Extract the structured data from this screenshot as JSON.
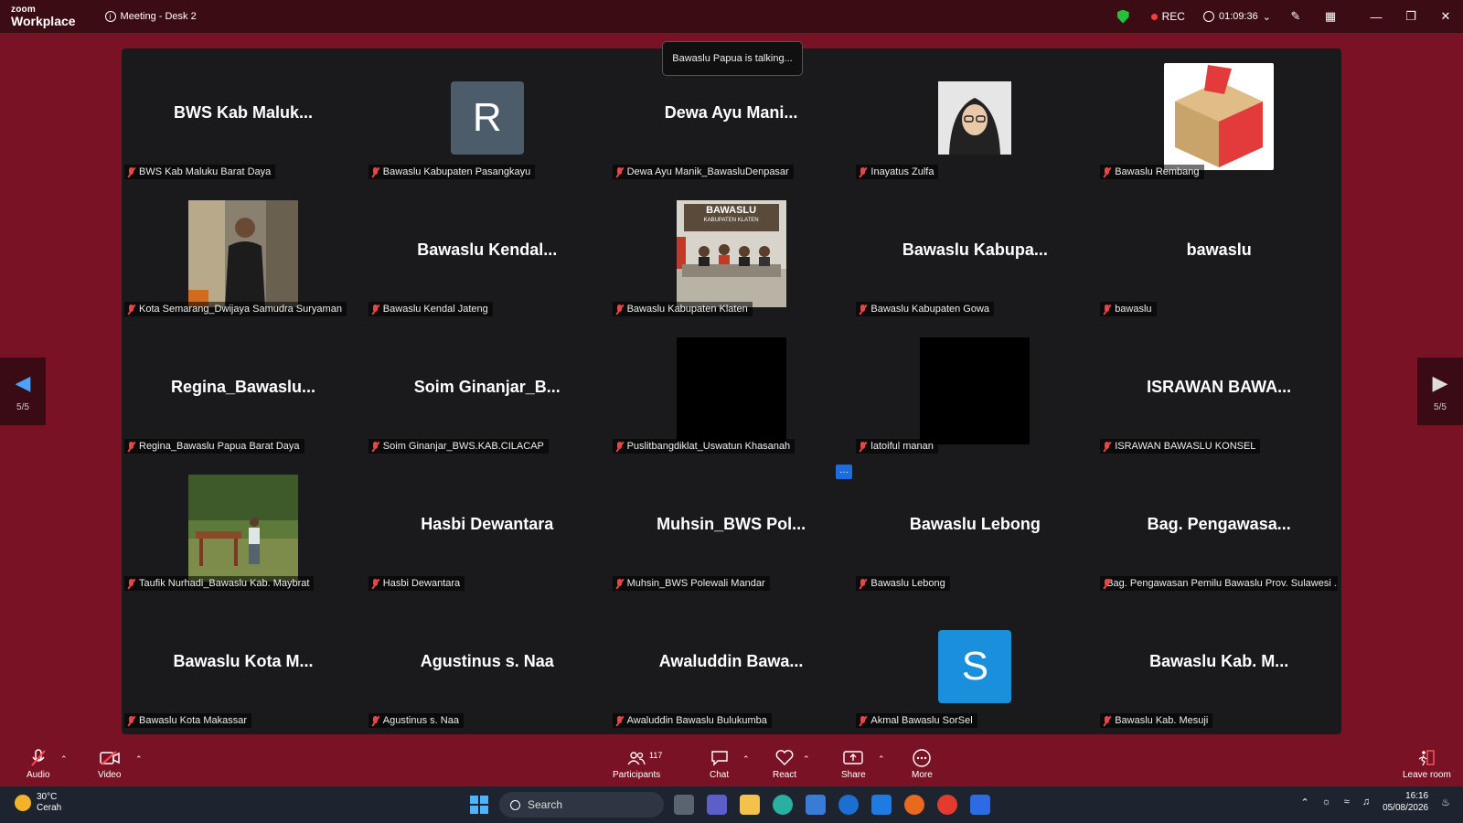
{
  "app": {
    "logo_top": "zoom",
    "logo_bottom": "Workplace",
    "meeting_title": "Meeting - Desk 2",
    "rec_label": "REC",
    "timer": "01:09:36"
  },
  "gallery": {
    "talking_banner": "Bawaslu Papua is talking...",
    "page_indicator_left": "5/5",
    "page_indicator_right": "5/5",
    "more_badge": "···",
    "tiles": [
      {
        "display": "BWS Kab Maluk...",
        "name": "BWS Kab Maluku Barat Daya",
        "kind": "text"
      },
      {
        "display": "R",
        "name": "Bawaslu Kabupaten Pasangkayu",
        "kind": "letter",
        "color": "#4c5c6a"
      },
      {
        "display": "Dewa Ayu Mani...",
        "name": "Dewa Ayu Manik_BawasluDenpasar",
        "kind": "text"
      },
      {
        "display": "",
        "name": "Inayatus Zulfa",
        "kind": "photo-portrait"
      },
      {
        "display": "",
        "name": "Bawaslu Rembang",
        "kind": "logo"
      },
      {
        "display": "",
        "name": "Kota Semarang_Dwijaya Samudra Suryaman",
        "kind": "photo-man"
      },
      {
        "display": "Bawaslu Kendal...",
        "name": "Bawaslu Kendal Jateng",
        "kind": "text"
      },
      {
        "display": "",
        "name": "Bawaslu Kabupaten Klaten",
        "kind": "photo-room",
        "banner": "BAWASLU",
        "banner_sub": "KABUPATEN KLATEN"
      },
      {
        "display": "Bawaslu Kabupa...",
        "name": "Bawaslu Kabupaten Gowa",
        "kind": "text"
      },
      {
        "display": "bawaslu",
        "name": "bawaslu",
        "kind": "text"
      },
      {
        "display": "Regina_Bawaslu...",
        "name": "Regina_Bawaslu Papua Barat Daya",
        "kind": "text"
      },
      {
        "display": "Soim Ginanjar_B...",
        "name": "Soim Ginanjar_BWS.KAB.CILACAP",
        "kind": "text"
      },
      {
        "display": "",
        "name": "Puslitbangdiklat_Uswatun Khasanah",
        "kind": "black"
      },
      {
        "display": "",
        "name": "latoiful manan",
        "kind": "black"
      },
      {
        "display": "ISRAWAN BAWA...",
        "name": "ISRAWAN BAWASLU KONSEL",
        "kind": "text"
      },
      {
        "display": "",
        "name": "Taufik Nurhadi_Bawaslu Kab. Maybrat",
        "kind": "photo-garden"
      },
      {
        "display": "Hasbi Dewantara",
        "name": "Hasbi Dewantara",
        "kind": "text"
      },
      {
        "display": "Muhsin_BWS Pol...",
        "name": "Muhsin_BWS Polewali Mandar",
        "kind": "text"
      },
      {
        "display": "Bawaslu Lebong",
        "name": "Bawaslu Lebong",
        "kind": "text"
      },
      {
        "display": "Bag. Pengawasa...",
        "name": "Bag. Pengawasan Pemilu Bawaslu Prov. Sulawesi ...",
        "kind": "text"
      },
      {
        "display": "Bawaslu Kota M...",
        "name": "Bawaslu Kota Makassar",
        "kind": "text"
      },
      {
        "display": "Agustinus s. Naa",
        "name": "Agustinus s. Naa",
        "kind": "text"
      },
      {
        "display": "Awaluddin Bawa...",
        "name": "Awaluddin Bawaslu Bulukumba",
        "kind": "text"
      },
      {
        "display": "S",
        "name": "Akmal Bawaslu SorSel",
        "kind": "letter",
        "color": "#1a8fdb"
      },
      {
        "display": "Bawaslu Kab. M...",
        "name": "Bawaslu Kab. Mesuji",
        "kind": "text"
      }
    ]
  },
  "toolbar": {
    "audio": "Audio",
    "video": "Video",
    "participants": "Participants",
    "participant_count": "117",
    "chat": "Chat",
    "react": "React",
    "share": "Share",
    "more": "More",
    "leave": "Leave room"
  },
  "taskbar": {
    "temperature": "30°C",
    "weather": "Cerah",
    "search_placeholder": "Search",
    "time": "16:16",
    "date": "05/08/2026"
  }
}
